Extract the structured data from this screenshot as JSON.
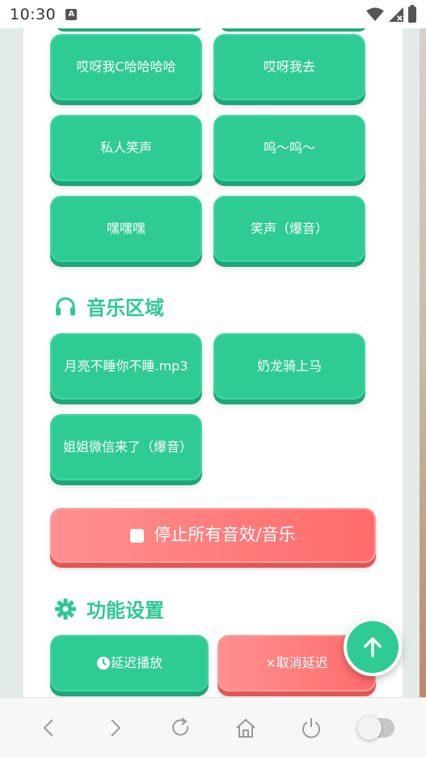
{
  "status_bar": {
    "time": "10:30",
    "notif_glyph": "A"
  },
  "sound_buttons": [
    {
      "label": "哎呀我C哈哈哈哈"
    },
    {
      "label": "哎呀我去"
    },
    {
      "label": "私人笑声"
    },
    {
      "label": "呜～呜～"
    },
    {
      "label": "嘿嘿嘿"
    },
    {
      "label": "笑声（爆音）"
    }
  ],
  "music_section": {
    "title": "音乐区域",
    "icon": "headphones-icon",
    "items": [
      {
        "label": "月亮不睡你不睡.mp3"
      },
      {
        "label": "奶龙骑上马"
      },
      {
        "label": "姐姐微信来了（爆音）"
      }
    ]
  },
  "stop_button": {
    "label": "停止所有音效/音乐"
  },
  "settings_section": {
    "title": "功能设置",
    "icon": "gear-icon",
    "delay_play_label": "延迟播放",
    "cancel_delay_label": "×取消延迟"
  },
  "colors": {
    "accent": "#2ecb93",
    "danger": "#ff6b6b"
  },
  "bottom_nav": {
    "icons": [
      "back-icon",
      "forward-icon",
      "refresh-icon",
      "home-icon",
      "power-icon",
      "toggle-switch"
    ]
  }
}
